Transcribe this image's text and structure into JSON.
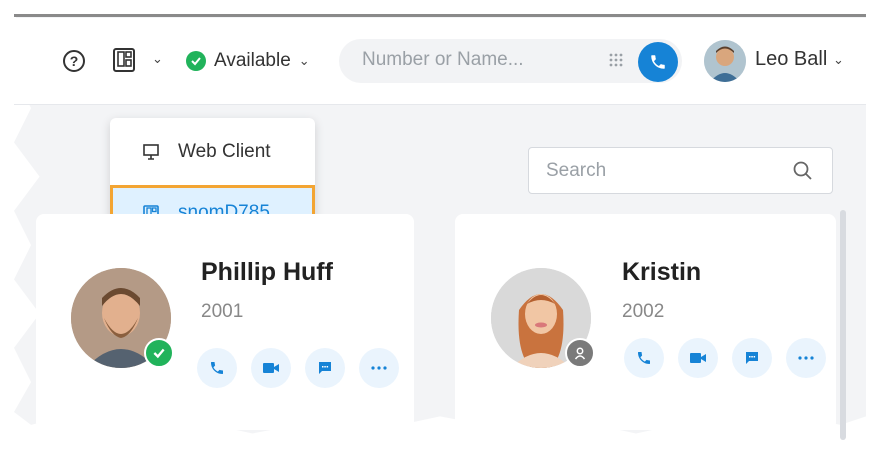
{
  "topbar": {
    "status_label": "Available",
    "search_placeholder": "Number or Name...",
    "user_name": "Leo Ball"
  },
  "dropdown": {
    "items": [
      {
        "label": "Web Client",
        "icon": "monitor-icon",
        "selected": false
      },
      {
        "label": "snomD785",
        "icon": "desk-phone-icon",
        "selected": true
      }
    ]
  },
  "search": {
    "placeholder": "Search"
  },
  "contacts": [
    {
      "name": "Phillip Huff",
      "ext": "2001",
      "presence": "available"
    },
    {
      "name": "Kristin",
      "ext": "2002",
      "presence": "offline"
    }
  ],
  "colors": {
    "accent": "#1683d6",
    "available": "#21b35b",
    "highlight_border": "#f3a533"
  }
}
